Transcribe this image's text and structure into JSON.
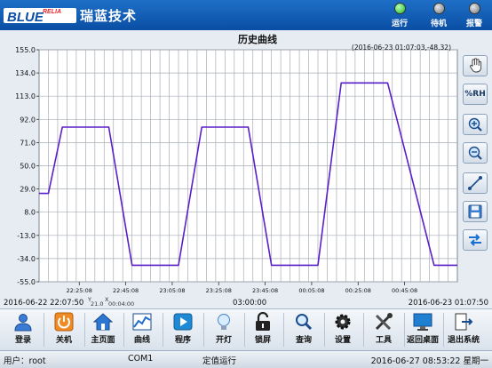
{
  "app": {
    "logo_text": "BLUE",
    "logo_small": "RELIA",
    "brand": "瑞蓝技术"
  },
  "status_lights": [
    {
      "label": "运行",
      "color": "#2bd62b"
    },
    {
      "label": "待机",
      "color": "#8a8f96"
    },
    {
      "label": "报警",
      "color": "#8a8f96"
    }
  ],
  "chart_data": {
    "type": "line",
    "title": "历史曲线",
    "cursor_readout": "(2016-06-23 01:07:03,-48.32)",
    "ylim": [
      -55.0,
      155.0
    ],
    "y_ticks": [
      "155.0",
      "134.0",
      "113.0",
      "92.0",
      "71.0",
      "50.0",
      "29.0",
      "8.0",
      "-13.0",
      "-34.0",
      "-55.0"
    ],
    "y_tick_values": [
      155.0,
      134.0,
      113.0,
      92.0,
      71.0,
      50.0,
      29.0,
      8.0,
      -13.0,
      -34.0,
      -55.0
    ],
    "x_start": "2016-06-22 22:07:50",
    "x_end": "2016-06-23 01:07:50",
    "x_center_label": "03:00:00",
    "x_tick_labels": [
      "22:25:08",
      "22:45:08",
      "23:05:08",
      "23:25:08",
      "23:45:08",
      "00:05:08",
      "00:25:08",
      "00:45:08"
    ],
    "x_tick_minutes": [
      17.3,
      37.3,
      57.3,
      77.3,
      97.3,
      117.3,
      137.3,
      157.3
    ],
    "x_range_minutes": [
      0,
      180
    ],
    "grid": true,
    "series": [
      {
        "color": "#5a1fc9",
        "points": [
          {
            "x": 0,
            "y": 25
          },
          {
            "x": 4,
            "y": 25
          },
          {
            "x": 10,
            "y": 85
          },
          {
            "x": 30,
            "y": 85
          },
          {
            "x": 40,
            "y": -40
          },
          {
            "x": 60,
            "y": -40
          },
          {
            "x": 70,
            "y": 85
          },
          {
            "x": 90,
            "y": 85
          },
          {
            "x": 100,
            "y": -40
          },
          {
            "x": 120,
            "y": -40
          },
          {
            "x": 130,
            "y": 125
          },
          {
            "x": 150,
            "y": 125
          },
          {
            "x": 170,
            "y": -40
          },
          {
            "x": 180,
            "y": -40
          }
        ]
      }
    ]
  },
  "scale_strip": {
    "y_label": "Y",
    "y_value": "21.0",
    "x_label": "X",
    "x_value": "00:04:00"
  },
  "side_buttons": [
    {
      "name": "hand-icon",
      "label": ""
    },
    {
      "name": "percent-rh-button",
      "label": "%RH"
    },
    {
      "name": "zoom-in-icon",
      "label": ""
    },
    {
      "name": "zoom-out-icon",
      "label": ""
    },
    {
      "name": "line-tool-icon",
      "label": ""
    },
    {
      "name": "save-icon",
      "label": ""
    },
    {
      "name": "swap-icon",
      "label": ""
    }
  ],
  "toolbar": [
    {
      "label": "登录",
      "icon": "user-icon"
    },
    {
      "label": "关机",
      "icon": "power-icon"
    },
    {
      "label": "主页面",
      "icon": "home-icon"
    },
    {
      "label": "曲线",
      "icon": "chart-icon"
    },
    {
      "label": "程序",
      "icon": "play-icon"
    },
    {
      "label": "开灯",
      "icon": "bulb-icon"
    },
    {
      "label": "锁屏",
      "icon": "lock-icon"
    },
    {
      "label": "查询",
      "icon": "search-icon"
    },
    {
      "label": "设置",
      "icon": "gear-icon"
    },
    {
      "label": "工具",
      "icon": "tools-icon"
    },
    {
      "label": "返回桌面",
      "icon": "desktop-icon"
    },
    {
      "label": "退出系统",
      "icon": "exit-icon"
    }
  ],
  "statusbar": {
    "user": "用户：root",
    "port": "COM1",
    "mode": "定值运行",
    "datetime": "2016-06-27 08:53:22 星期一"
  }
}
